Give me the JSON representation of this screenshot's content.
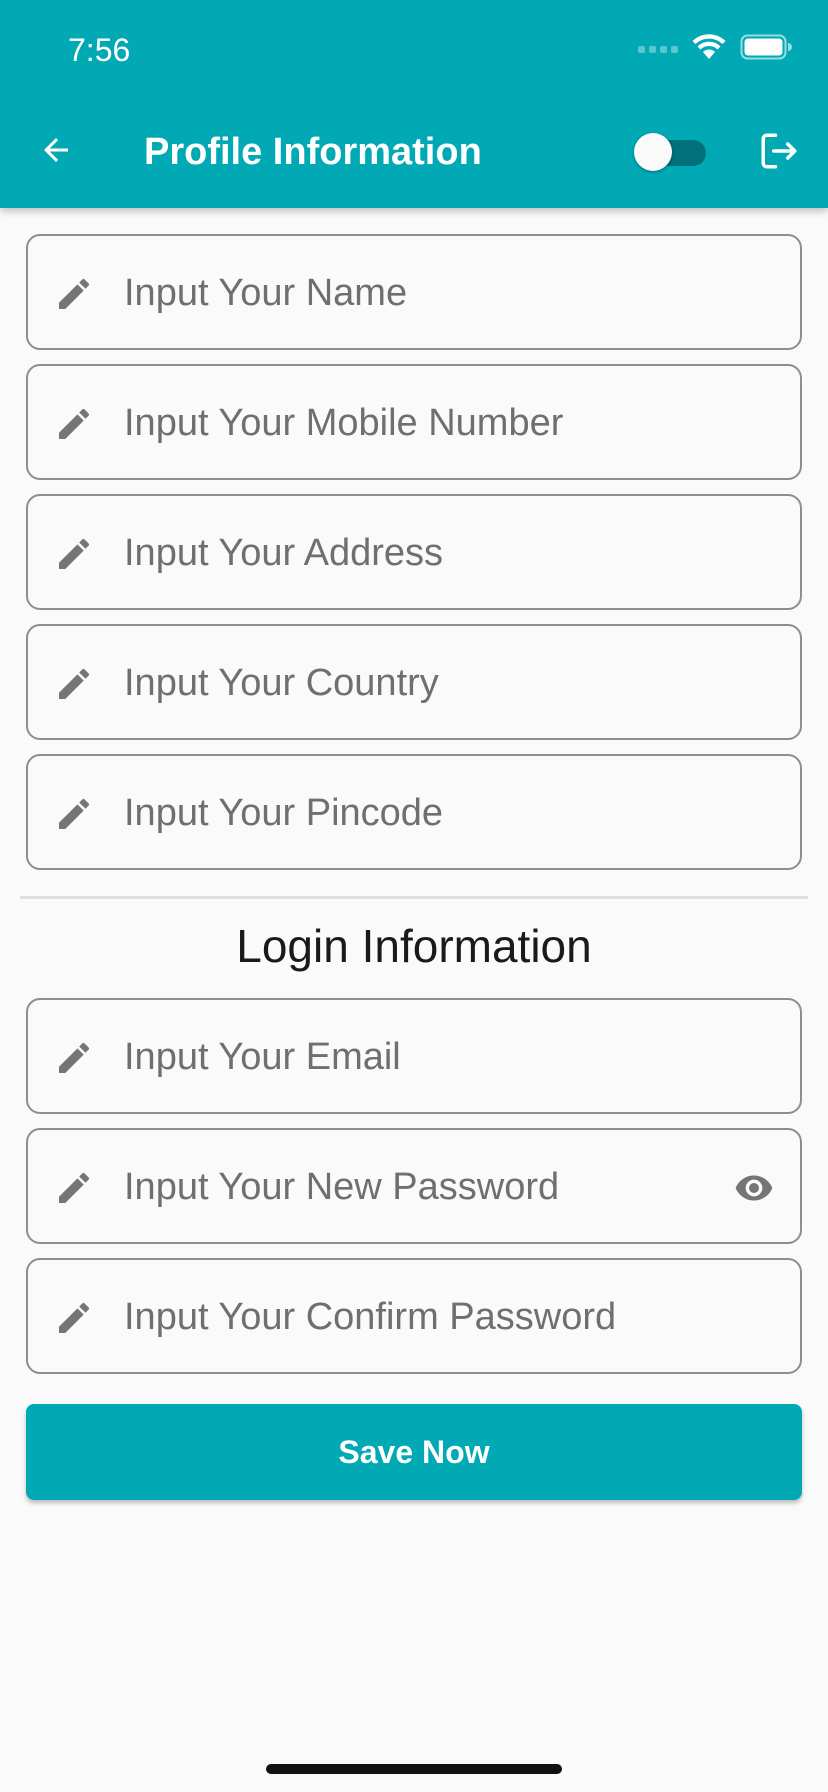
{
  "status_bar": {
    "time": "7:56"
  },
  "header": {
    "title": "Profile Information",
    "back_icon": "arrow-left-icon",
    "toggle_state": "off",
    "logout_icon": "logout-icon"
  },
  "profile_fields": [
    {
      "placeholder": "Input Your Name",
      "icon": "pencil-icon"
    },
    {
      "placeholder": "Input Your Mobile Number",
      "icon": "pencil-icon"
    },
    {
      "placeholder": "Input Your Address",
      "icon": "pencil-icon"
    },
    {
      "placeholder": "Input Your Country",
      "icon": "pencil-icon"
    },
    {
      "placeholder": "Input Your Pincode",
      "icon": "pencil-icon"
    }
  ],
  "login_section": {
    "title": "Login Information",
    "fields": [
      {
        "placeholder": "Input Your Email",
        "icon": "pencil-icon"
      },
      {
        "placeholder": "Input Your New Password",
        "icon": "pencil-icon",
        "trailing_icon": "eye-icon"
      },
      {
        "placeholder": "Input Your Confirm Password",
        "icon": "pencil-icon"
      }
    ]
  },
  "save_button": {
    "label": "Save Now"
  },
  "colors": {
    "primary": "#00a9b4",
    "toggle_track": "#00707a",
    "field_border": "#8e8e8e",
    "placeholder_text": "#6f6f6f",
    "background": "#fafafa"
  }
}
